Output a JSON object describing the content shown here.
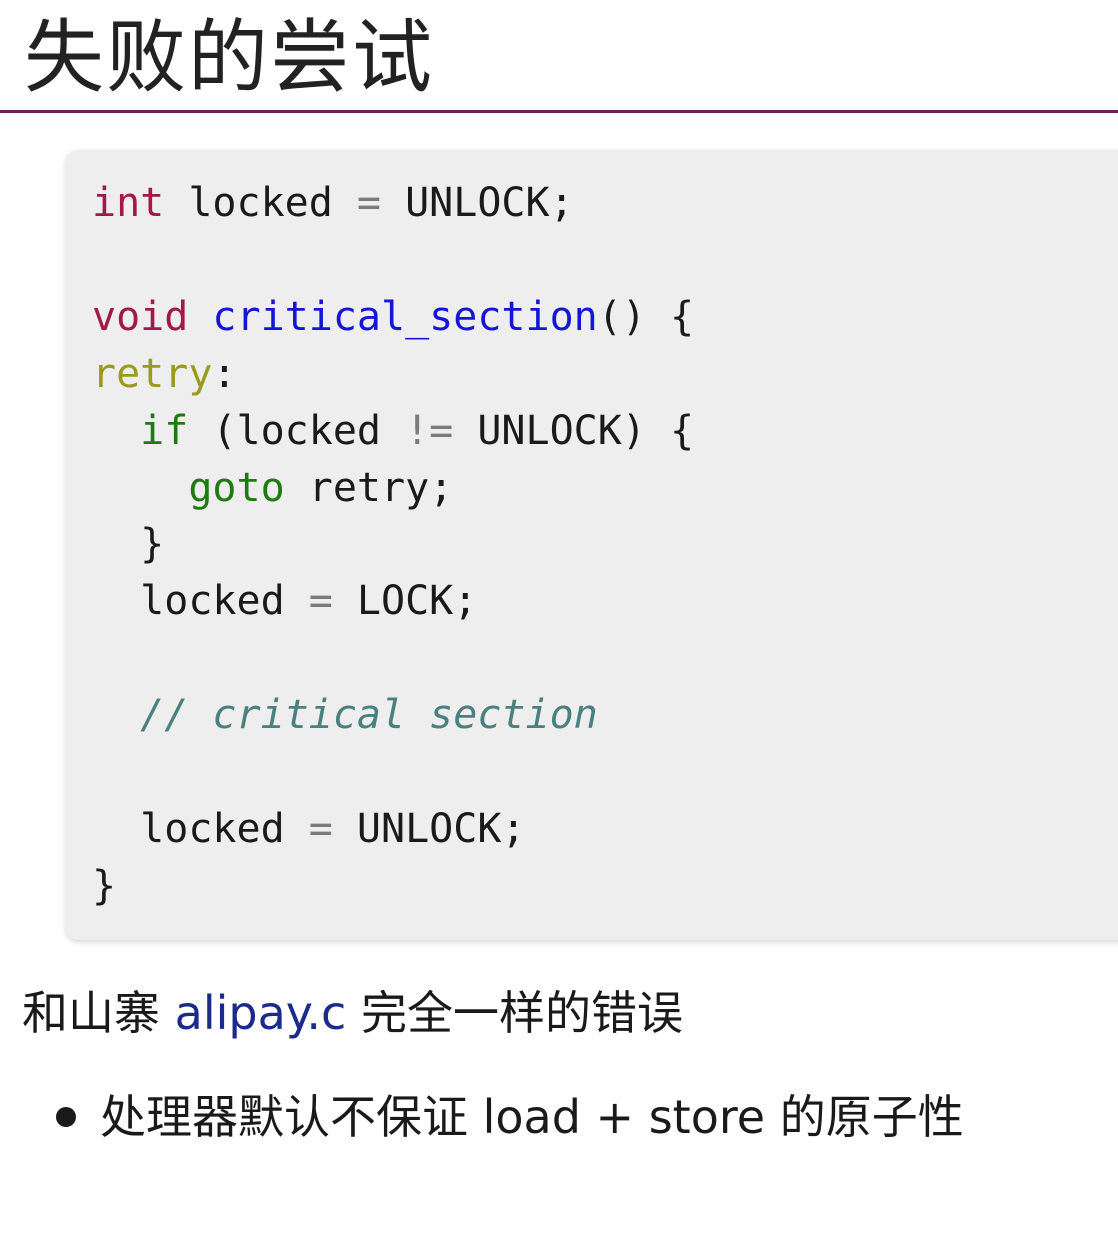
{
  "title": "失败的尝试",
  "code": {
    "line1": {
      "type": "int",
      "rest": " locked ",
      "op": "=",
      "rest2": " UNLOCK;"
    },
    "line3": {
      "type": "void",
      "fn": "critical_section",
      "rest": "() {"
    },
    "line4": {
      "label": "retry",
      "rest": ":"
    },
    "line5": {
      "indent": "  ",
      "kw": "if",
      "rest": " (locked ",
      "op": "!=",
      "rest2": " UNLOCK) {"
    },
    "line6": {
      "indent": "    ",
      "kw": "goto",
      "rest": " retry;"
    },
    "line7": {
      "text": "  }"
    },
    "line8": {
      "indent": "  ",
      "rest": "locked ",
      "op": "=",
      "rest2": " LOCK;"
    },
    "line10": {
      "indent": "  ",
      "comment": "// critical section"
    },
    "line12": {
      "indent": "  ",
      "rest": "locked ",
      "op": "=",
      "rest2": " UNLOCK;"
    },
    "line13": {
      "text": "}"
    }
  },
  "paragraph": {
    "before": "和山寨 ",
    "link": "alipay.c",
    "after": " 完全一样的错误"
  },
  "bullets": [
    {
      "text": "处理器默认不保证 load + store 的原子性"
    }
  ],
  "colors": {
    "title_rule": "#6b1f5c",
    "code_bg": "#eeeeee",
    "type_keyword": "#a3184a",
    "control_keyword": "#1f7a12",
    "function_name": "#1515d6",
    "label": "#9a9a1e",
    "comment": "#4a8080",
    "link": "#1c2a8c"
  }
}
